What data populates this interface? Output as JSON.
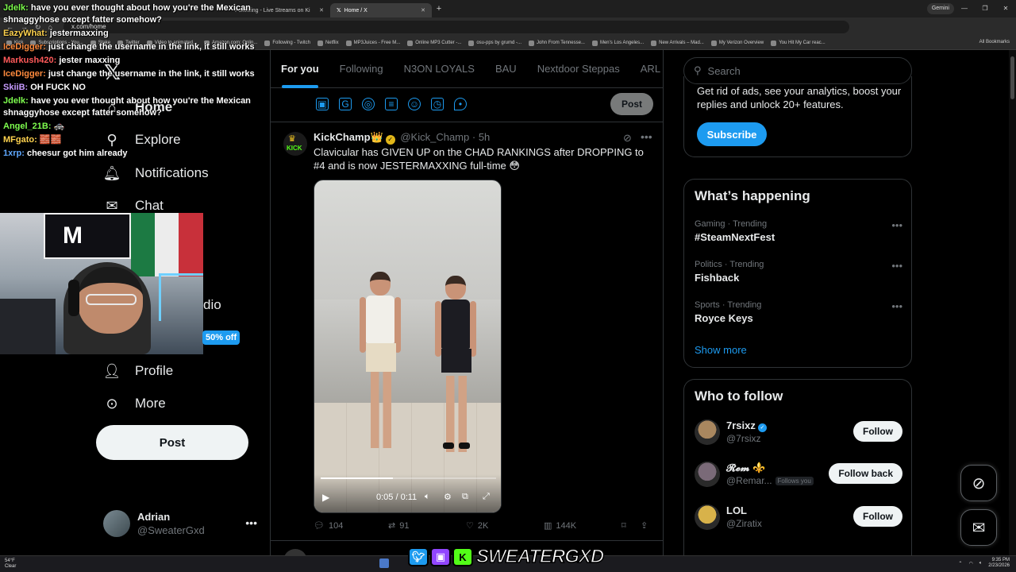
{
  "browser": {
    "tabs": [
      {
        "label": "Following - Live Streams on Ki",
        "active": false
      },
      {
        "label": "Home / X",
        "active": true
      }
    ],
    "gemini_label": "Gemini",
    "url": "x.com/home",
    "bookmarks": [
      "Kick",
      "Subscriptions - You...",
      "Stake",
      "Twitter",
      "Video to animated...",
      "Amazon.com: Onlin...",
      "Following - Twitch",
      "Netflix",
      "MP3Juices - Free M...",
      "Online MP3 Cutter -...",
      "osu-pps by grumd -...",
      "John From Tennesse...",
      "Men's Los Angeles...",
      "New Arrivals – Mad...",
      "My Verizon Overview",
      "You Hit My Car reac..."
    ],
    "all_bookmarks": "All Bookmarks"
  },
  "nav": {
    "home": "Home",
    "explore": "Explore",
    "notifications": "Notifications",
    "chat": "Chat",
    "audio_partial": "dio",
    "promo": "50% off",
    "profile": "Profile",
    "more": "More",
    "post": "Post",
    "account": {
      "name": "Adrian",
      "handle": "@SweaterGxd"
    }
  },
  "chat_overlay": [
    {
      "user": "Jdelk:",
      "text": "have you ever thought about how you're the Mexican shnaggyhose except fatter somehow?",
      "color": "#7fff4f"
    },
    {
      "user": "EazyWhat:",
      "text": "jestermaxxing",
      "color": "#ffd34f"
    },
    {
      "user": "IceDigger:",
      "text": "just change the username in the link, it still works",
      "color": "#ff8a3d"
    },
    {
      "user": "Markush420:",
      "text": "jester maxxing",
      "color": "#ff5a5a"
    },
    {
      "user": "IceDigger:",
      "text": "just change the username in the link, it still works",
      "color": "#ff8a3d"
    },
    {
      "user": "SkiiB:",
      "text": "OH FUCK NO",
      "color": "#c79bff"
    },
    {
      "user": "Jdelk:",
      "text": "have you ever thought about how you're the Mexican shnaggyhose except fatter somehow?",
      "color": "#7fff4f"
    },
    {
      "user": "Angel_21B:",
      "text": "🚓",
      "color": "#7fff4f"
    },
    {
      "user": "MFgato:",
      "text": "🧱🧱",
      "color": "#ffd34f"
    },
    {
      "user": "1xrp:",
      "text": "cheesur got him already",
      "color": "#5fa8ff"
    }
  ],
  "webcam": {
    "flag_text": "M"
  },
  "timeline": {
    "tabs": [
      "For you",
      "Following",
      "N3ON LOYALS",
      "BAU",
      "Nextdoor Steppas",
      "ARL"
    ],
    "active_tab": "For you",
    "compose_post": "Post"
  },
  "tweet": {
    "name": "KickChamp👑",
    "handle": "@Kick_Champ",
    "time": "5h",
    "text": "Clavicular has GIVEN UP on the CHAD RANKINGS after DROPPING to #4 and is now JESTERMAXXING full-time 😳",
    "avatar_text": "KICK",
    "video_time": "0:05 / 0:11",
    "video_progress": 0.41,
    "replies": "104",
    "reposts": "91",
    "likes": "2K",
    "views": "144K"
  },
  "right": {
    "search_placeholder": "Search",
    "premium_text": "Get rid of ads, see your analytics, boost your replies and unlock 20+ features.",
    "subscribe": "Subscribe",
    "happening_title": "What’s happening",
    "trends": [
      {
        "meta": "Gaming · Trending",
        "topic": "#SteamNextFest"
      },
      {
        "meta": "Politics · Trending",
        "topic": "Fishback"
      },
      {
        "meta": "Sports · Trending",
        "topic": "Royce Keys"
      }
    ],
    "show_more": "Show more",
    "wtf_title": "Who to follow",
    "follow": [
      {
        "name": "7rsixz",
        "handle": "@7rsixz",
        "button": "Follow",
        "verified": true,
        "follows_you": false,
        "avatar_color": "#a9875f"
      },
      {
        "name": "𝓡𝓮𝓶 ⚜️",
        "handle": "@Remar...",
        "button": "Follow back",
        "verified": false,
        "follows_you": true,
        "follows_you_label": "Follows you",
        "avatar_color": "#7a6a78"
      },
      {
        "name": "LOL",
        "handle": "@Ziratix",
        "button": "Follow",
        "verified": false,
        "follows_you": false,
        "avatar_color": "#d8b24a"
      }
    ]
  },
  "overlay_brand": "SWEATERGXD",
  "taskbar": {
    "weather_temp": "54°F",
    "weather_desc": "Clear",
    "time": "9:35 PM",
    "date": "2/23/2026"
  }
}
